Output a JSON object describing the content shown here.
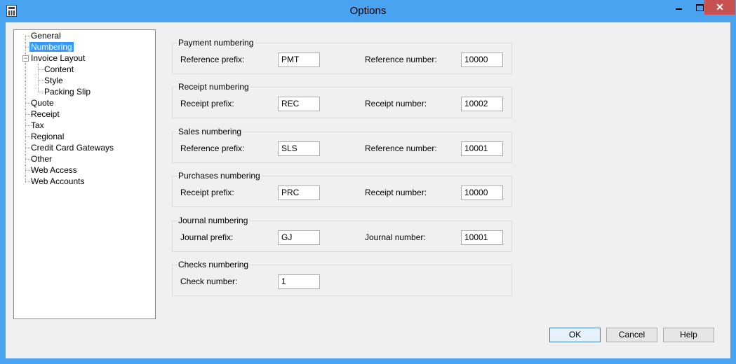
{
  "window": {
    "title": "Options",
    "close_glyph": "✕"
  },
  "tree": {
    "items": [
      {
        "label": "General"
      },
      {
        "label": "Numbering"
      },
      {
        "label": "Invoice Layout",
        "expander": "−"
      },
      {
        "label": "Content"
      },
      {
        "label": "Style"
      },
      {
        "label": "Packing Slip"
      },
      {
        "label": "Quote"
      },
      {
        "label": "Receipt"
      },
      {
        "label": "Tax"
      },
      {
        "label": "Regional"
      },
      {
        "label": "Credit Card Gateways"
      },
      {
        "label": "Other"
      },
      {
        "label": "Web Access"
      },
      {
        "label": "Web Accounts"
      }
    ],
    "selected": "Numbering"
  },
  "groups": [
    {
      "title": "Payment numbering",
      "prefix_label": "Reference prefix:",
      "prefix_value": "PMT",
      "number_label": "Reference number:",
      "number_value": "10000"
    },
    {
      "title": "Receipt numbering",
      "prefix_label": "Receipt prefix:",
      "prefix_value": "REC",
      "number_label": "Receipt number:",
      "number_value": "10002"
    },
    {
      "title": "Sales numbering",
      "prefix_label": "Reference prefix:",
      "prefix_value": "SLS",
      "number_label": "Reference number:",
      "number_value": "10001"
    },
    {
      "title": "Purchases numbering",
      "prefix_label": "Receipt prefix:",
      "prefix_value": "PRC",
      "number_label": "Receipt number:",
      "number_value": "10000"
    },
    {
      "title": "Journal numbering",
      "prefix_label": "Journal prefix:",
      "prefix_value": "GJ",
      "number_label": "Journal number:",
      "number_value": "10001"
    },
    {
      "title": "Checks numbering",
      "prefix_label": "Check number:",
      "prefix_value": "1"
    }
  ],
  "buttons": {
    "ok": "OK",
    "cancel": "Cancel",
    "help": "Help"
  },
  "colors": {
    "title_bar": "#4aa3f0",
    "selection": "#3399ff",
    "close_button": "#c75050"
  }
}
